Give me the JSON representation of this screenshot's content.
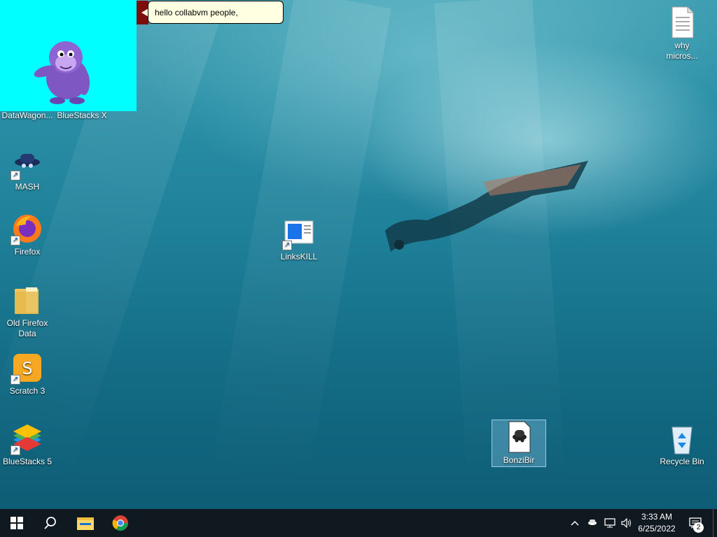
{
  "desktop": {
    "icons": [
      {
        "label": "DataWagon..."
      },
      {
        "label": "BlueStacks X"
      },
      {
        "label": "MASH"
      },
      {
        "label": "Firefox"
      },
      {
        "label": "Old Firefox\nData"
      },
      {
        "label": "Scratch 3"
      },
      {
        "label": "BlueStacks 5"
      },
      {
        "label": "LinksKILL"
      },
      {
        "label": "why\nmicros..."
      },
      {
        "label": "BonziBir"
      },
      {
        "label": "Recycle Bin"
      }
    ]
  },
  "agent": {
    "speech": "hello collabvm people,",
    "background_color": "#00ffff"
  },
  "taskbar": {
    "start_icon": "windows-logo-icon",
    "search_icon": "search-icon",
    "apps": [
      "file-explorer-icon",
      "chrome-icon"
    ],
    "tray": {
      "time": "3:33 AM",
      "date": "6/25/2022",
      "notifications_count": "2"
    }
  }
}
